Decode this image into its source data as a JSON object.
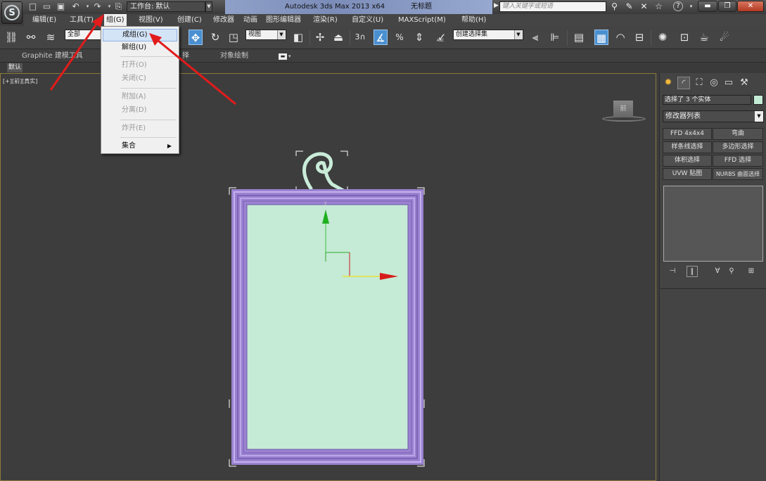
{
  "titlebar": {
    "workspace_label": "工作台: 默认",
    "app_title": "Autodesk 3ds Max  2013 x64",
    "doc_title": "无标题",
    "search_placeholder": "键入关键字或短语"
  },
  "menubar": {
    "items": [
      "编辑(E)",
      "工具(T)",
      "组(G)",
      "视图(V)",
      "创建(C)",
      "修改器",
      "动画",
      "图形编辑器",
      "渲染(R)",
      "自定义(U)",
      "MAXScript(M)",
      "帮助(H)"
    ]
  },
  "toolbar": {
    "selection_filter": "全部",
    "ref_coord": "视图",
    "snap_3": "3",
    "named_selection": "创建选择集",
    "named_sel_icon_text": "ABC"
  },
  "group_menu": {
    "items": [
      {
        "label": "成组(G)",
        "enabled": true
      },
      {
        "label": "解组(U)",
        "enabled": true
      },
      {
        "label": "打开(O)",
        "enabled": false
      },
      {
        "label": "关闭(C)",
        "enabled": false
      },
      {
        "label": "附加(A)",
        "enabled": false
      },
      {
        "label": "分离(D)",
        "enabled": false
      },
      {
        "label": "炸开(E)",
        "enabled": false
      },
      {
        "label": "集合",
        "enabled": true
      }
    ]
  },
  "ribbon": {
    "tab_graphite": "Graphite 建模工具",
    "tab_selection": "择",
    "tab_object_paint": "对象绘制",
    "sub_default": "默认"
  },
  "viewport": {
    "label": "[+][前][真实]",
    "viewcube_label": "前"
  },
  "command_panel": {
    "selection_text": "选择了 3 个实体",
    "modifier_list": "修改器列表",
    "modifier_buttons": [
      "FFD 4x4x4",
      "弯曲",
      "样条线选择",
      "多边形选择",
      "体积选择",
      "FFD 选择",
      "UVW 贴图",
      "NURBS 曲面选择"
    ]
  },
  "colors": {
    "frame_purple": "#a48ad6",
    "canvas_green": "#c5ead5",
    "hook_green": "#c9ecd9",
    "arrow_red": "#e21b1b",
    "highlight_blue": "#4a8fd0"
  }
}
